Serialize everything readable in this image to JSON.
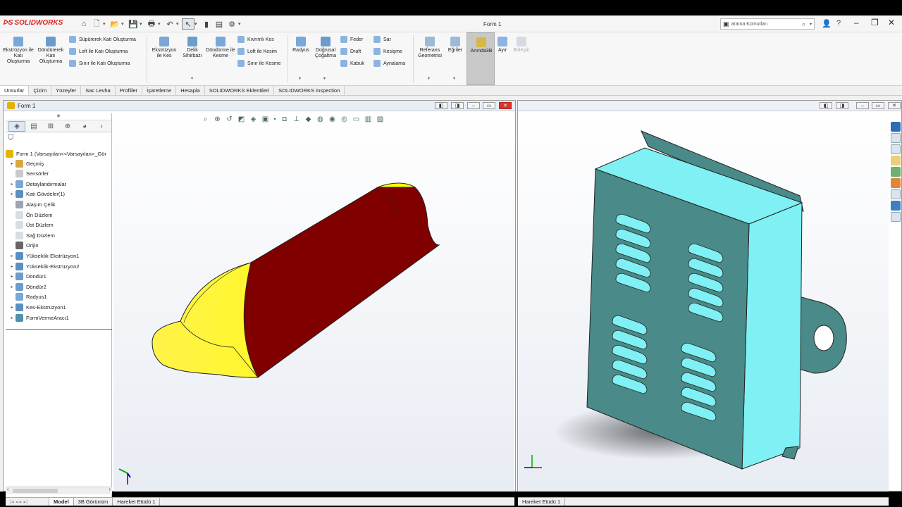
{
  "app": {
    "brand": "SOLIDWORKS",
    "window_title": "Form 1",
    "search_placeholder": "arama Komutları"
  },
  "ribbon": {
    "extrude_boss": "Ekstrüzyon ile Katı Oluşturma",
    "revolve_boss": "Döndürerek Katı Oluşturma",
    "sweep_boss": "Süpürerek Katı Oluşturma",
    "loft_boss": "Loft ile Katı Oluşturma",
    "boundary_boss": "Sınır ile Katı Oluşturma",
    "extrude_cut": "Ekstrüzyon ile Kes",
    "hole_wizard": "Delik Sihirbazı",
    "revolve_cut": "Döndürme ile Kesme",
    "swept_cut": "Kıvrımlı Kes",
    "loft_cut": "Loft ile Kesim",
    "boundary_cut": "Sınır ile Kesme",
    "fillet": "Radyus",
    "linear_pattern": "Doğrusal Çoğaltma",
    "rib": "Feder",
    "draft": "Draft",
    "shell": "Kabuk",
    "wrap": "Sar",
    "intersect": "Kesişme",
    "mirror": "Aynalama",
    "ref_geometry": "Referans Geometrisi",
    "curves": "Eğriler",
    "instant3d": "Anında3B",
    "split": "Ayır",
    "combine": "Birleştir"
  },
  "tabs": [
    "Unsurlar",
    "Çizim",
    "Yüzeyler",
    "Sac Levha",
    "Profiller",
    "İşaretleme",
    "Hesapla",
    "SOLIDWORKS Eklentileri",
    "SOLIDWORKS Inspection"
  ],
  "left_pane": {
    "title": "Form 1"
  },
  "tree": {
    "root": "Form 1  (Varsayılan<<Varsayılan>_Gör",
    "items": [
      {
        "label": "Geçmiş",
        "expandable": true
      },
      {
        "label": "Sensörler",
        "expandable": false
      },
      {
        "label": "Detaylandırmalar",
        "expandable": true
      },
      {
        "label": "Katı Gövdeler(1)",
        "expandable": true
      },
      {
        "label": "Alaşım Çelik",
        "expandable": false
      },
      {
        "label": "Ön Düzlem",
        "expandable": false
      },
      {
        "label": "Üst Düzlem",
        "expandable": false
      },
      {
        "label": "Sağ Düzlem",
        "expandable": false
      },
      {
        "label": "Orijin",
        "expandable": false
      },
      {
        "label": "Yükseklik-Ekstrüzyon1",
        "expandable": true
      },
      {
        "label": "Yükseklik-Ekstrüzyon2",
        "expandable": true
      },
      {
        "label": "Döndür1",
        "expandable": true
      },
      {
        "label": "Döndür2",
        "expandable": true
      },
      {
        "label": "Radyus1",
        "expandable": false
      },
      {
        "label": "Kes-Ekstrüzyon1",
        "expandable": true
      },
      {
        "label": "FormVermeAracı1",
        "expandable": true
      }
    ]
  },
  "bottom_tabs": {
    "left": [
      "Model",
      "3B Görünüm",
      "Hareket Etüdü 1"
    ],
    "right": "Hareket Etüdü 1"
  },
  "colors": {
    "yellow_face": "#ffff00",
    "red_face": "#800000",
    "box_face": "#4a8a88",
    "box_top": "#7ff0f4"
  }
}
